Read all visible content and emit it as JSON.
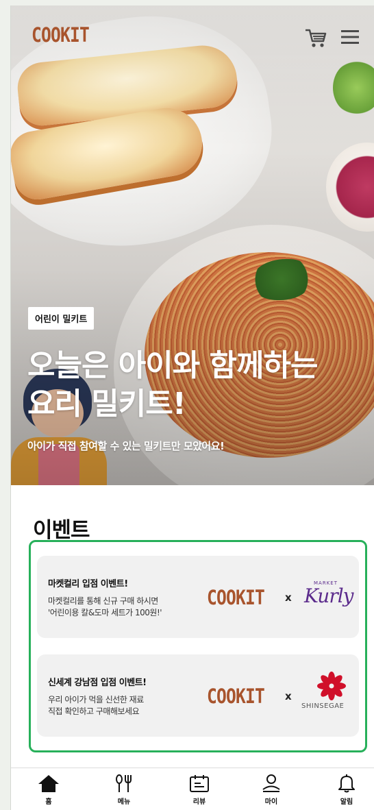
{
  "header": {
    "logo": "COOKIT",
    "cart_icon": "cart-icon",
    "menu_icon": "hamburger-menu-icon"
  },
  "hero": {
    "badge": "어린이 밀키트",
    "title_line1": "오늘은 아이와 함께하는",
    "title_line2": "요리 밀키트!",
    "subtitle": "아이가 직접 참여할 수 있는 밀키트만 모았어요!"
  },
  "events": {
    "title": "이벤트",
    "highlight_color": "#27b05a",
    "items": [
      {
        "title": "마켓컬리 입점 이벤트!",
        "desc_line1": "마켓컬리를 통해 신규 구매 하시면",
        "desc_line2": "'어린이용 칼&도마 세트가 100원!'",
        "brand": "COOKIT",
        "separator": "x",
        "partner_small": "MARKET",
        "partner": "Kurly"
      },
      {
        "title": "신세계 강남점 입점 이벤트!",
        "desc_line1": "우리 아이가 먹을 신선한 재료",
        "desc_line2": "직접 확인하고 구매해보세요",
        "brand": "COOKIT",
        "separator": "x",
        "partner": "SHINSEGAE"
      }
    ]
  },
  "nav": {
    "items": [
      {
        "label": "홈",
        "icon": "home-icon"
      },
      {
        "label": "메뉴",
        "icon": "utensils-icon"
      },
      {
        "label": "리뷰",
        "icon": "review-icon"
      },
      {
        "label": "마이",
        "icon": "user-icon"
      },
      {
        "label": "알림",
        "icon": "bell-icon"
      }
    ]
  },
  "colors": {
    "brand": "#a8542d",
    "kurly": "#5b2b8c",
    "shinsegae": "#d0102a"
  }
}
